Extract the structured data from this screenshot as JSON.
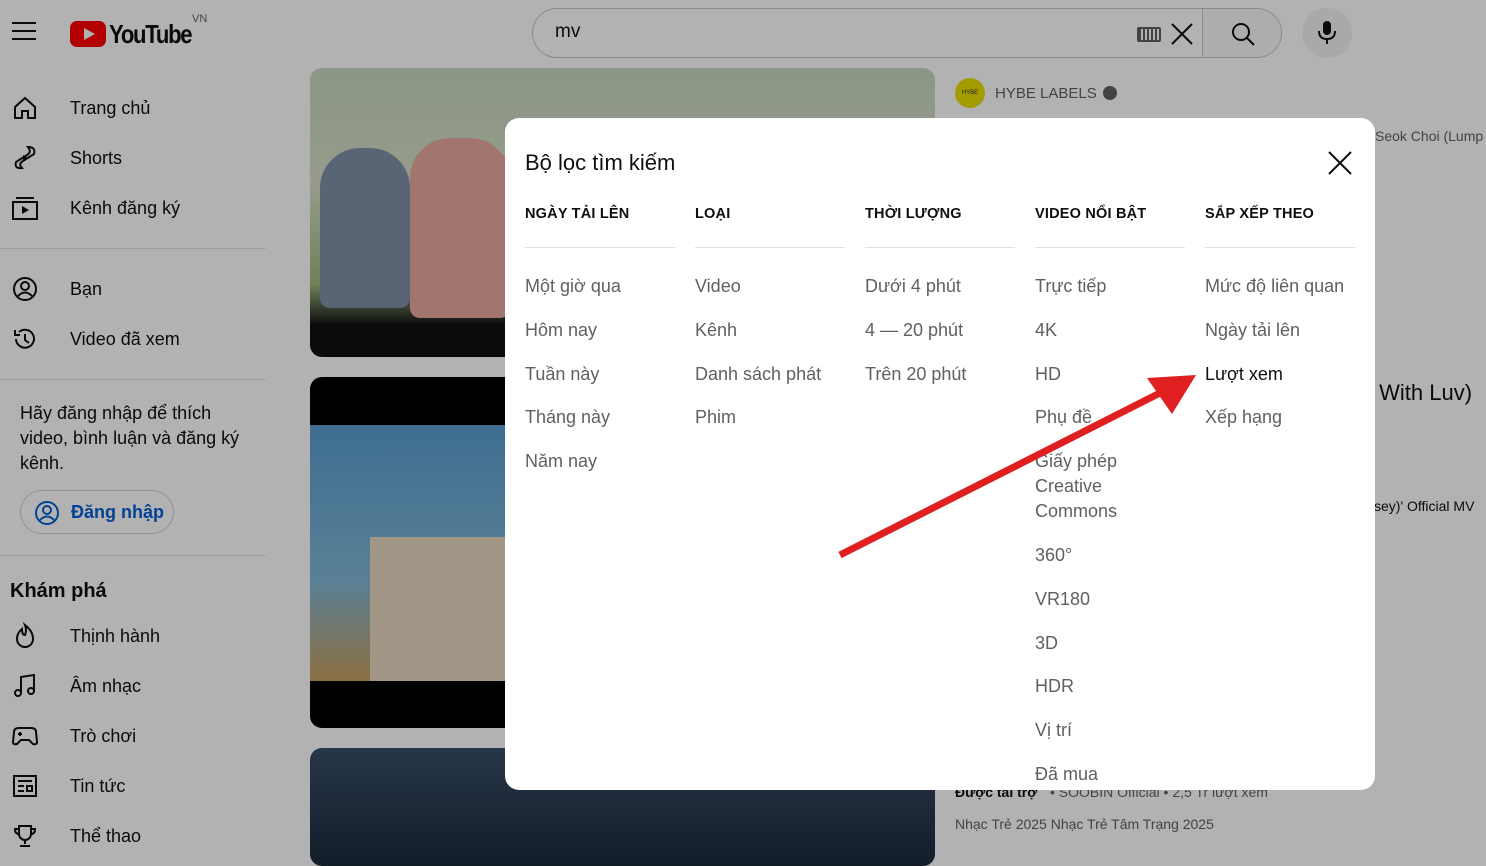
{
  "header": {
    "logo_text": "YouTube",
    "country": "VN",
    "search_value": "mv"
  },
  "sidebar": {
    "top_items": [
      {
        "label": "Trang chủ",
        "icon": "home-icon"
      },
      {
        "label": "Shorts",
        "icon": "shorts-icon"
      },
      {
        "label": "Kênh đăng ký",
        "icon": "subscriptions-icon"
      }
    ],
    "you_items": [
      {
        "label": "Bạn",
        "icon": "user-icon"
      },
      {
        "label": "Video đã xem",
        "icon": "history-icon"
      }
    ],
    "signin_prompt": "Hãy đăng nhập để thích video, bình luận và đăng ký kênh.",
    "signin_label": "Đăng nhập",
    "explore_title": "Khám phá",
    "explore_items": [
      {
        "label": "Thịnh hành",
        "icon": "trending-icon"
      },
      {
        "label": "Âm nhạc",
        "icon": "music-icon"
      },
      {
        "label": "Trò chơi",
        "icon": "gaming-icon"
      },
      {
        "label": "Tin tức",
        "icon": "news-icon"
      },
      {
        "label": "Thể thao",
        "icon": "trophy-icon"
      }
    ]
  },
  "background": {
    "channel_name": "HYBE LABELS",
    "avatar_text": "HYBE",
    "snippet_1": "Seok Choi (Lump",
    "snippet_2": "y With Luv)",
    "snippet_3": "sey)' Official MV",
    "sponsored_label": "Được tài trợ",
    "sponsored_meta": "• SOOBIN Official • 2,5 Tr lượt xem",
    "sponsored_desc": "Nhạc Trẻ 2025 Nhạc Trẻ Tâm Trạng 2025"
  },
  "dialog": {
    "title": "Bộ lọc tìm kiếm",
    "columns": [
      {
        "heading": "NGÀY TẢI LÊN",
        "items": [
          "Một giờ qua",
          "Hôm nay",
          "Tuần này",
          "Tháng này",
          "Năm nay"
        ]
      },
      {
        "heading": "LOẠI",
        "items": [
          "Video",
          "Kênh",
          "Danh sách phát",
          "Phim"
        ]
      },
      {
        "heading": "THỜI LƯỢNG",
        "items": [
          "Dưới 4 phút",
          "4 — 20 phút",
          "Trên 20 phút"
        ]
      },
      {
        "heading": "VIDEO NỔI BẬT",
        "items": [
          "Trực tiếp",
          "4K",
          "HD",
          "Phụ đề",
          "Giấy phép Creative Commons",
          "360°",
          "VR180",
          "3D",
          "HDR",
          "Vị trí",
          "Đã mua"
        ]
      },
      {
        "heading": "SẮP XẾP THEO",
        "items": [
          "Mức độ liên quan",
          "Ngày tải lên",
          "Lượt xem",
          "Xếp hạng"
        ]
      }
    ],
    "active_sort": "Lượt xem"
  },
  "colors": {
    "accent": "#065fd4",
    "brand": "#ff0000",
    "arrow": "#e02020"
  }
}
